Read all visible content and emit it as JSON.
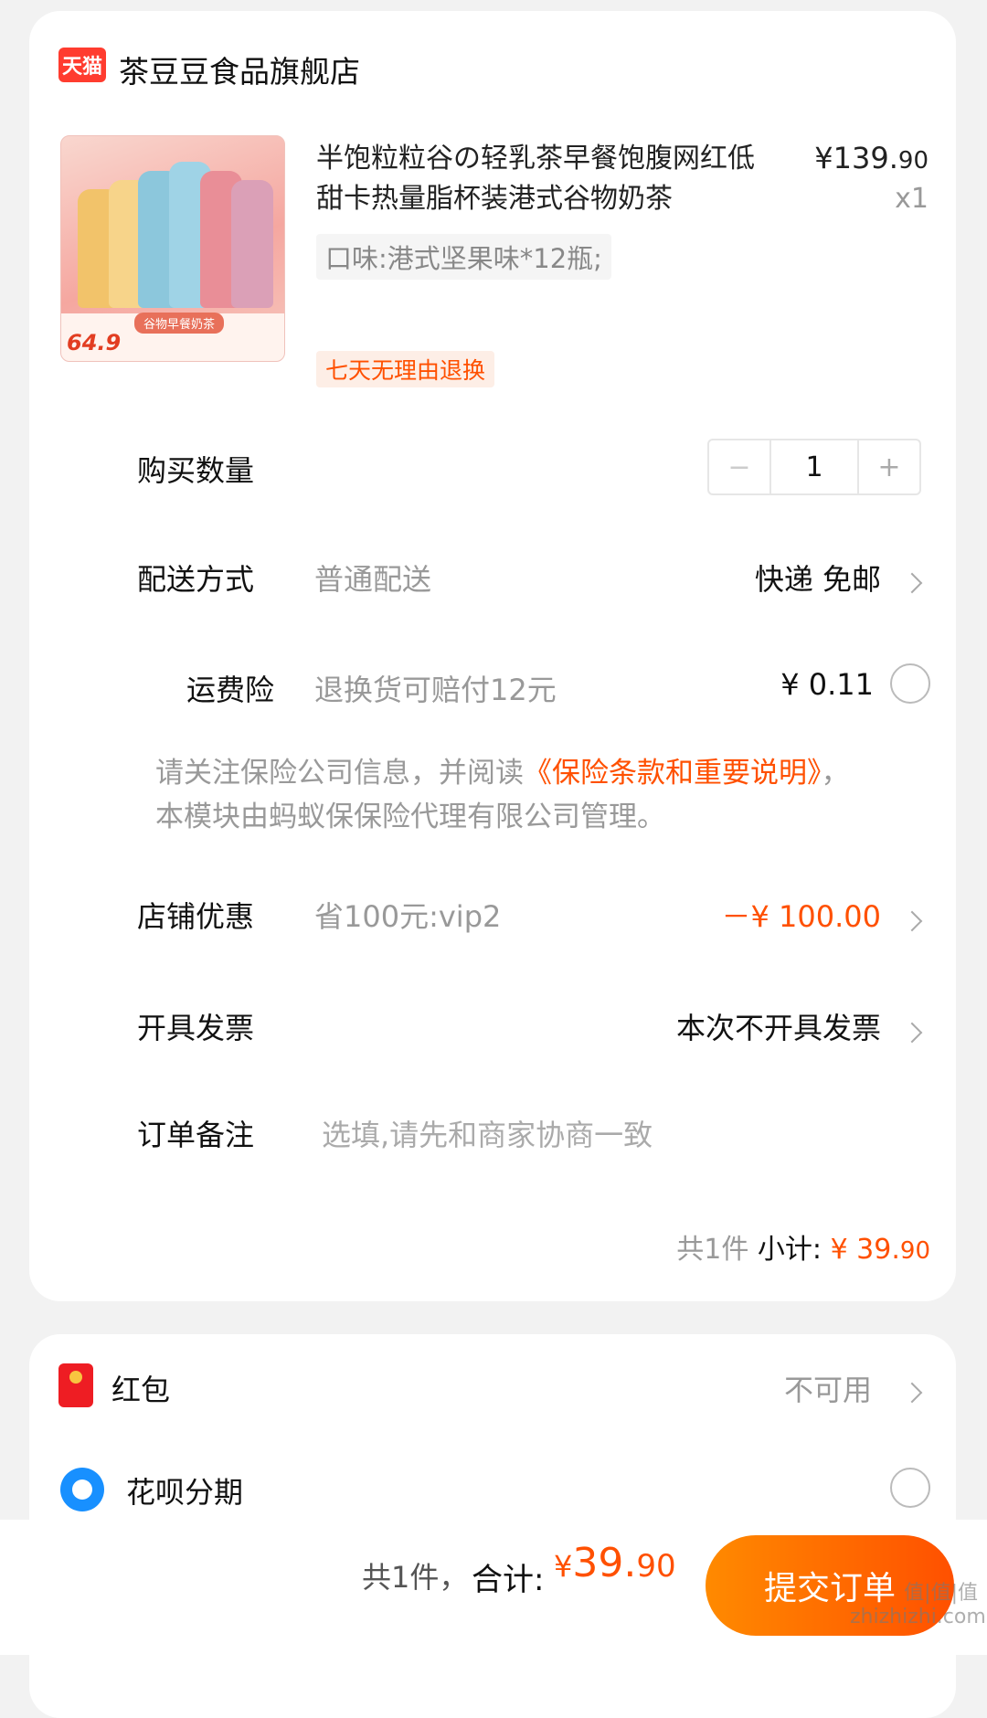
{
  "shop": {
    "logo_text": "天猫",
    "name": "茶豆豆食品旗舰店"
  },
  "product": {
    "title": "半饱粒粒谷の轻乳茶早餐饱腹网红低甜卡热量脂杯装港式谷物奶茶",
    "price_main": "¥139.",
    "price_decimal": "90",
    "quantity_label": "x1",
    "spec": "口味:港式坚果味*12瓶;",
    "return_tag": "七天无理由退换",
    "thumb_price": "64.9",
    "thumb_tag": "谷物早餐奶茶"
  },
  "quantity": {
    "label": "购买数量",
    "value": "1",
    "minus": "−",
    "plus": "+"
  },
  "delivery": {
    "label": "配送方式",
    "sub": "普通配送",
    "value": "快递 免邮"
  },
  "insurance": {
    "label": "运费险",
    "sub": "退换货可赔付12元",
    "value": "¥ 0.11"
  },
  "notice": {
    "text1": "请关注保险公司信息，并阅读",
    "link": "《保险条款和重要说明》",
    "text2": "，",
    "text3": "本模块由蚂蚁保保险代理有限公司管理。"
  },
  "discount": {
    "label": "店铺优惠",
    "sub": "省100元:vip2",
    "value": "－¥ 100.00"
  },
  "invoice": {
    "label": "开具发票",
    "value": "本次不开具发票"
  },
  "remark": {
    "label": "订单备注",
    "placeholder": "选填,请先和商家协商一致"
  },
  "subtotal": {
    "count": "共1件",
    "label": "小计:",
    "amount_main": "¥ 39.",
    "amount_decimal": "90"
  },
  "redpacket": {
    "label": "红包",
    "value": "不可用"
  },
  "huabei": {
    "label": "花呗分期"
  },
  "footer": {
    "count": "共1件，",
    "total_label": "合计:",
    "currency": "¥",
    "amount_main": "39.",
    "amount_decimal": "90",
    "submit_label": "提交订单"
  },
  "watermark": "值|值|值 zhizhizhi.com",
  "colors": {
    "accent": "#ff5000",
    "brand": "#ff3c2f"
  }
}
